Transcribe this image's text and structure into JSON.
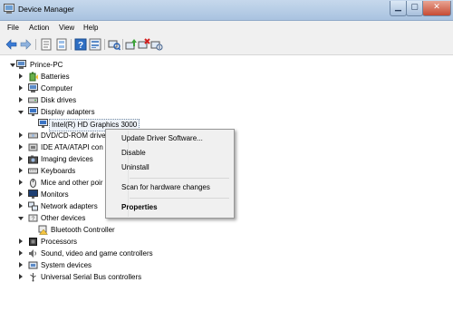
{
  "window": {
    "title": "Device Manager"
  },
  "menu": [
    "File",
    "Action",
    "View",
    "Help"
  ],
  "toolbar": {
    "buttons": [
      "back-icon",
      "forward-icon",
      "properties-icon",
      "list-icon",
      "help-icon",
      "details-icon",
      "scan-icon",
      "update-driver-icon",
      "uninstall-icon",
      "disable-icon"
    ]
  },
  "tree": {
    "root": "Prince-PC",
    "items": [
      {
        "label": "Batteries"
      },
      {
        "label": "Computer"
      },
      {
        "label": "Disk drives"
      },
      {
        "label": "Display adapters"
      },
      {
        "label": "Intel(R) HD Graphics 3000"
      },
      {
        "label": "DVD/CD-ROM drive"
      },
      {
        "label": "IDE ATA/ATAPI con"
      },
      {
        "label": "Imaging devices"
      },
      {
        "label": "Keyboards"
      },
      {
        "label": "Mice and other poir"
      },
      {
        "label": "Monitors"
      },
      {
        "label": "Network adapters"
      },
      {
        "label": "Other devices"
      },
      {
        "label": "Bluetooth Controller"
      },
      {
        "label": "Processors"
      },
      {
        "label": "Sound, video and game controllers"
      },
      {
        "label": "System devices"
      },
      {
        "label": "Universal Serial Bus controllers"
      }
    ]
  },
  "context_menu": {
    "update": "Update Driver Software...",
    "disable": "Disable",
    "uninstall": "Uninstall",
    "scan": "Scan for hardware changes",
    "properties": "Properties"
  }
}
